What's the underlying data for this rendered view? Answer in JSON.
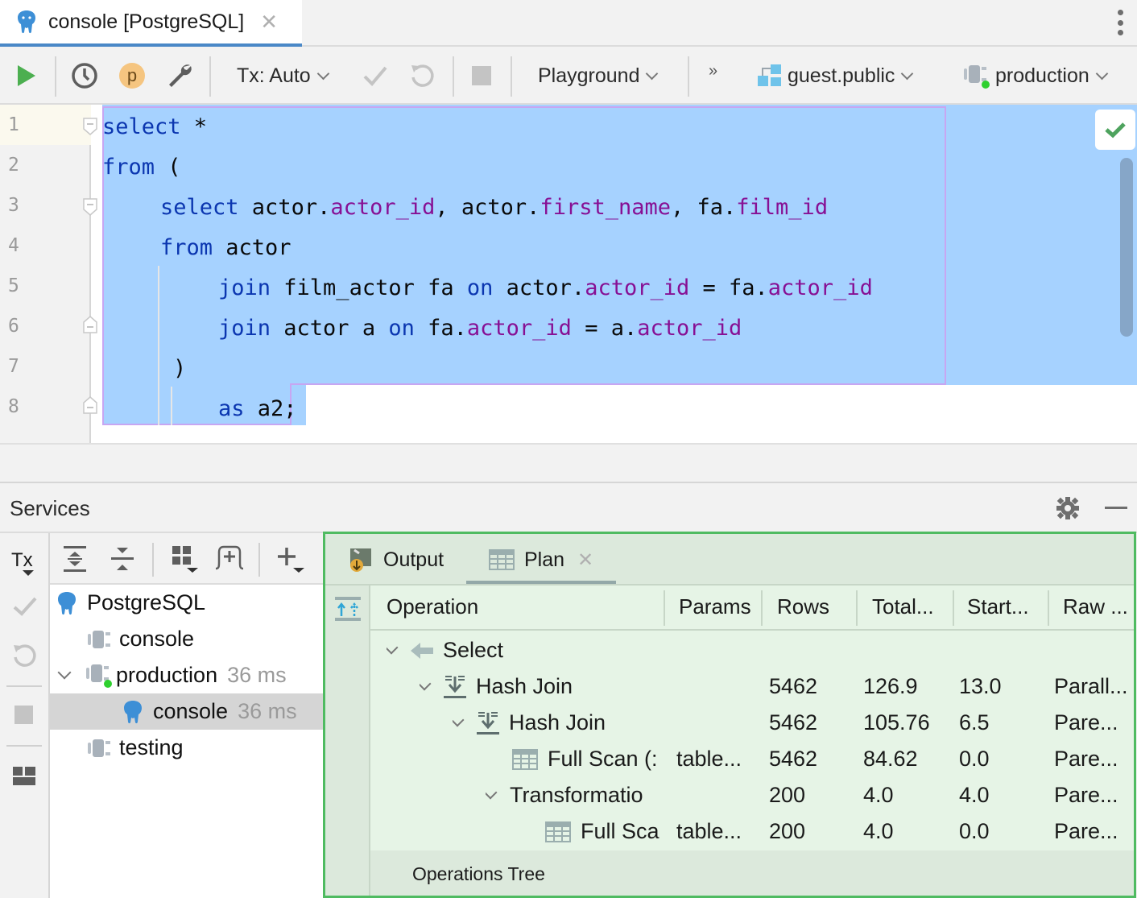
{
  "tab": {
    "label": "console [PostgreSQL]",
    "icon": "postgresql-elephant-icon"
  },
  "toolbar": {
    "tx_mode": "Tx: Auto",
    "playground": "Playground",
    "overflow": "»",
    "schema": "guest.public",
    "datasource": "production",
    "profile_badge": "p"
  },
  "editor": {
    "lines": [
      {
        "n": "1",
        "tokens": [
          [
            "kw",
            "select"
          ],
          [
            "",
            "&#32;*"
          ]
        ]
      },
      {
        "n": "2"
      },
      {
        "n": "3"
      },
      {
        "n": "4"
      },
      {
        "n": "5"
      },
      {
        "n": "6"
      },
      {
        "n": "7"
      },
      {
        "n": "8"
      }
    ],
    "line_numbers": [
      "1",
      "2",
      "3",
      "4",
      "5",
      "6",
      "7",
      "8"
    ],
    "code": {
      "l1": {
        "kw1": "select",
        "t1": " *"
      },
      "l2": {
        "kw1": "from",
        "t1": " ("
      },
      "l3": {
        "kw1": "select",
        "t1": " actor.",
        "f1": "actor_id",
        "t2": ", actor.",
        "f2": "first_name",
        "t3": ", fa.",
        "f3": "film_id"
      },
      "l4": {
        "kw1": "from",
        "t1": " actor"
      },
      "l5": {
        "kw1": "join",
        "t1": " film_actor fa ",
        "kw2": "on",
        "t2": " actor.",
        "f1": "actor_id",
        "t3": " = fa.",
        "f2": "actor_id"
      },
      "l6": {
        "kw1": "join",
        "t1": " actor a ",
        "kw2": "on",
        "t2": " fa.",
        "f1": "actor_id",
        "t3": " = a.",
        "f2": "actor_id"
      },
      "l7": {
        "t1": ")"
      },
      "l8": {
        "kw1": "as",
        "t1": " a2",
        "t2": ";"
      }
    },
    "status": "no-problems"
  },
  "services": {
    "title": "Services",
    "tx_label": "Tx",
    "tree": [
      {
        "label": "PostgreSQL",
        "time": ""
      },
      {
        "label": "console",
        "time": ""
      },
      {
        "label": "production",
        "time": "36 ms"
      },
      {
        "label": "console",
        "time": "36 ms"
      },
      {
        "label": "testing",
        "time": ""
      }
    ]
  },
  "plan": {
    "tabs": [
      {
        "label": "Output"
      },
      {
        "label": "Plan"
      }
    ],
    "columns": [
      "Operation",
      "Params",
      "Rows",
      "Total...",
      "Start...",
      "Raw ..."
    ],
    "rows": [
      {
        "operation": "Select",
        "params": "",
        "rows": "",
        "total": "",
        "start": "",
        "raw": ""
      },
      {
        "operation": "Hash Join",
        "params": "",
        "rows": "5462",
        "total": "126.9",
        "start": "13.0",
        "raw": "Parall..."
      },
      {
        "operation": "Hash Join",
        "params": "",
        "rows": "5462",
        "total": "105.76",
        "start": "6.5",
        "raw": "Pare..."
      },
      {
        "operation": "Full Scan (:",
        "params": "table...",
        "rows": "5462",
        "total": "84.62",
        "start": "0.0",
        "raw": "Pare..."
      },
      {
        "operation": "Transformatio",
        "params": "",
        "rows": "200",
        "total": "4.0",
        "start": "4.0",
        "raw": "Pare..."
      },
      {
        "operation": "Full Sca",
        "params": "table...",
        "rows": "200",
        "total": "4.0",
        "start": "0.0",
        "raw": "Pare..."
      }
    ],
    "footer": "Operations Tree"
  },
  "colors": {
    "accent": "#4a88c7",
    "selection": "#a6d2ff",
    "keyword": "#0b36b0",
    "field": "#871094",
    "run": "#4caf50",
    "plan_border": "#4fbb61"
  }
}
